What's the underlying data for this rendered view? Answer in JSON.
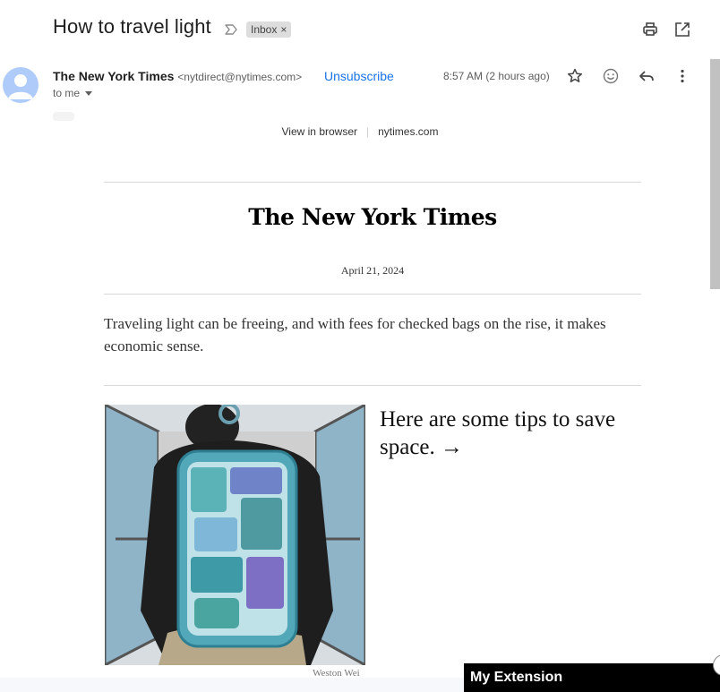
{
  "email": {
    "subject": "How to travel light",
    "label": "Inbox",
    "label_remove": "×",
    "sender_name": "The New York Times",
    "sender_email": "<nytdirect@nytimes.com>",
    "unsubscribe": "Unsubscribe",
    "time": "8:57 AM (2 hours ago)",
    "recipient": "to me"
  },
  "newsletter": {
    "view_in_browser": "View in browser",
    "separator": "|",
    "site_link": "nytimes.com",
    "masthead": "The New York Times",
    "date": "April 21, 2024",
    "intro": "Traveling light can be freeing, and with fees for checked bags on the rise, it makes economic sense.",
    "headline": "Here are some tips to save space. →",
    "image_credit": "Weston Wei"
  },
  "extension": {
    "title": "My Extension"
  },
  "icons": {
    "print": "print-icon",
    "open_new_window": "open-in-new-window-icon",
    "star": "star-icon",
    "emoji": "emoji-reaction-icon",
    "reply": "reply-icon",
    "more": "more-vertical-icon",
    "importance": "importance-marker-icon"
  }
}
